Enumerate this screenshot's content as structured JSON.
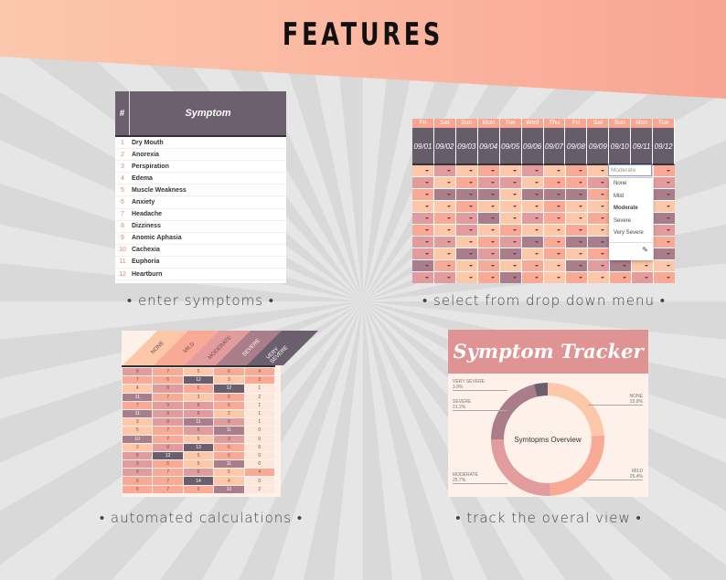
{
  "header": {
    "title": "FEATURES"
  },
  "colors": {
    "none": "#fdc8a9",
    "mild": "#f9aa96",
    "moderate": "#e39c9e",
    "severe": "#a97d8a",
    "very_severe": "#6b5f6e"
  },
  "symptoms_panel": {
    "col_num": "#",
    "col_symptom": "Symptom",
    "rows": [
      [
        "1",
        "Dry Mouth"
      ],
      [
        "2",
        "Anorexia"
      ],
      [
        "3",
        "Perspiration"
      ],
      [
        "4",
        "Edema"
      ],
      [
        "5",
        "Muscle Weakness"
      ],
      [
        "6",
        "Anxiety"
      ],
      [
        "7",
        "Headache"
      ],
      [
        "8",
        "Dizziness"
      ],
      [
        "9",
        "Anomic Aphasia"
      ],
      [
        "10",
        "Cachexia"
      ],
      [
        "11",
        "Euphoria"
      ],
      [
        "12",
        "Heartburn"
      ]
    ],
    "caption": "• enter symptoms •"
  },
  "dropdown_panel": {
    "days": [
      "Fri",
      "Sat",
      "Sun",
      "Mon",
      "Tue",
      "Wed",
      "Thu",
      "Fri",
      "Sat",
      "Sun",
      "Mon",
      "Tue"
    ],
    "dates": [
      "09/01",
      "09/02",
      "09/03",
      "09/04",
      "09/05",
      "09/06",
      "09/07",
      "09/08",
      "09/09",
      "09/10",
      "09/11",
      "09/12"
    ],
    "levels": [
      [
        0,
        2,
        0,
        1,
        0,
        2,
        0,
        1,
        0,
        0,
        0,
        1
      ],
      [
        2,
        0,
        1,
        2,
        2,
        0,
        1,
        1,
        2,
        0,
        0,
        2
      ],
      [
        1,
        3,
        3,
        3,
        0,
        3,
        3,
        3,
        1,
        0,
        0,
        3
      ],
      [
        0,
        0,
        1,
        0,
        0,
        0,
        1,
        0,
        0,
        0,
        0,
        0
      ],
      [
        2,
        1,
        2,
        3,
        0,
        2,
        1,
        0,
        1,
        0,
        0,
        3
      ],
      [
        1,
        0,
        2,
        0,
        1,
        0,
        0,
        1,
        0,
        0,
        0,
        2
      ],
      [
        2,
        2,
        0,
        1,
        2,
        3,
        1,
        3,
        3,
        0,
        0,
        1
      ],
      [
        2,
        0,
        3,
        2,
        3,
        0,
        1,
        0,
        1,
        0,
        0,
        3
      ],
      [
        3,
        1,
        0,
        1,
        0,
        1,
        0,
        3,
        2,
        3,
        0,
        0
      ],
      [
        2,
        2,
        0,
        1,
        3,
        1,
        0,
        1,
        0,
        1,
        2,
        1
      ]
    ],
    "input_value": "Moderate",
    "options": [
      "None",
      "Mild",
      "Moderate",
      "Severe",
      "Very Severe"
    ],
    "selected": "Moderate",
    "caption": "• select from drop down menu •"
  },
  "calc_panel": {
    "headers": [
      "NONE",
      "MILD",
      "MODERATE",
      "SEVERE",
      "VERY SEVERE"
    ],
    "rows": [
      [
        9,
        7,
        5,
        6,
        4
      ],
      [
        7,
        6,
        12,
        3,
        3
      ],
      [
        4,
        8,
        6,
        12,
        1
      ],
      [
        11,
        7,
        3,
        6,
        2
      ],
      [
        7,
        9,
        8,
        6,
        1
      ],
      [
        11,
        9,
        8,
        2,
        1
      ],
      [
        3,
        8,
        11,
        8,
        1
      ],
      [
        5,
        7,
        8,
        11,
        0
      ],
      [
        10,
        7,
        5,
        9,
        0
      ],
      [
        3,
        9,
        13,
        6,
        0
      ],
      [
        8,
        12,
        5,
        6,
        0
      ],
      [
        9,
        6,
        5,
        11,
        0
      ],
      [
        9,
        7,
        8,
        5,
        4
      ],
      [
        6,
        7,
        14,
        4,
        0
      ],
      [
        6,
        7,
        6,
        10,
        2
      ]
    ],
    "caption": "• automated calculations •"
  },
  "overview_panel": {
    "title": "Symptom Tracker",
    "center_label": "Symtopms Overview",
    "slices": [
      {
        "label": "NONE",
        "pct": "23.9%",
        "value": 23.9
      },
      {
        "label": "MILD",
        "pct": "25.4%",
        "value": 25.4
      },
      {
        "label": "MODERATE",
        "pct": "25.7%",
        "value": 25.7
      },
      {
        "label": "SEVERE",
        "pct": "21.2%",
        "value": 21.2
      },
      {
        "label": "VERY SEVERE",
        "pct": "3.9%",
        "value": 3.9
      }
    ],
    "caption": "• track the overal view •"
  }
}
